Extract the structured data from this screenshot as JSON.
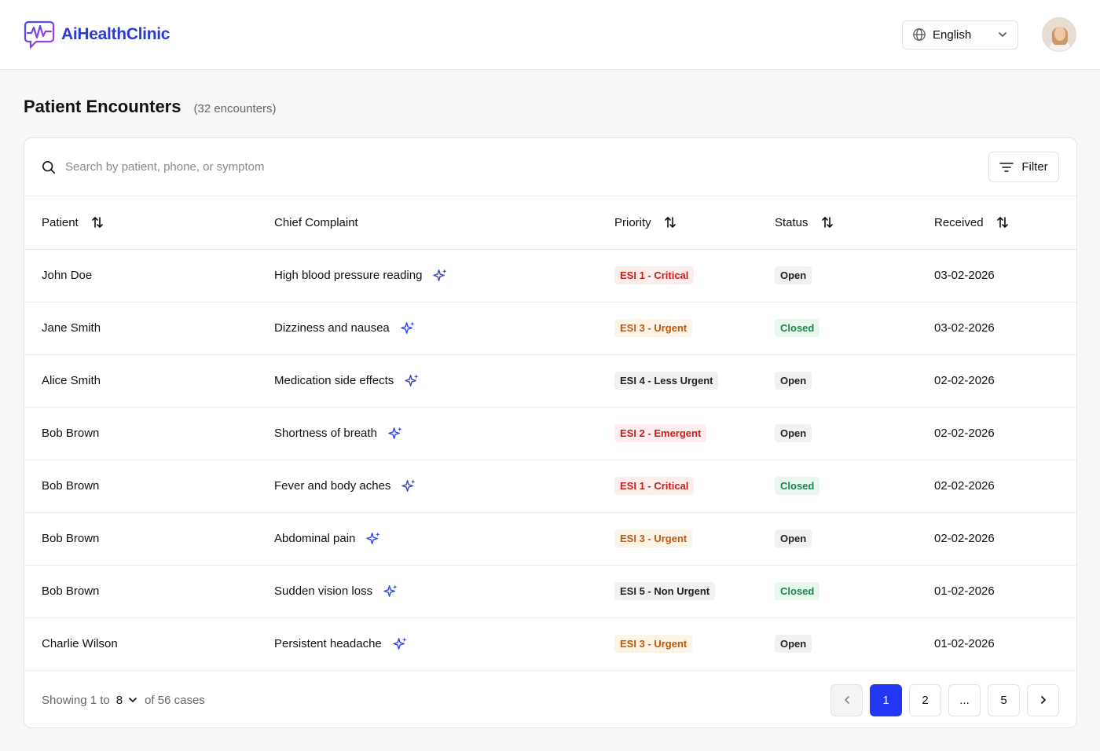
{
  "brand": {
    "name": "AiHealthClinic"
  },
  "header": {
    "language": "English"
  },
  "page": {
    "title": "Patient Encounters",
    "count": "(32 encounters)"
  },
  "search": {
    "placeholder": "Search by patient, phone, or symptom"
  },
  "filter": {
    "label": "Filter"
  },
  "columns": {
    "patient": "Patient",
    "complaint": "Chief Complaint",
    "priority": "Priority",
    "status": "Status",
    "received": "Received"
  },
  "rows": [
    {
      "patient": "John Doe",
      "complaint": "High blood pressure reading",
      "priority": "ESI 1 - Critical",
      "status": "Open",
      "received": "03-02-2026"
    },
    {
      "patient": "Jane Smith",
      "complaint": "Dizziness and nausea",
      "priority": "ESI 3 - Urgent",
      "status": "Closed",
      "received": "03-02-2026"
    },
    {
      "patient": "Alice Smith",
      "complaint": "Medication side effects",
      "priority": "ESI 4 - Less Urgent",
      "status": "Open",
      "received": "02-02-2026"
    },
    {
      "patient": "Bob Brown",
      "complaint": "Shortness of breath",
      "priority": "ESI 2 - Emergent",
      "status": "Open",
      "received": "02-02-2026"
    },
    {
      "patient": "Bob Brown",
      "complaint": "Fever and body aches",
      "priority": "ESI 1 - Critical",
      "status": "Closed",
      "received": "02-02-2026"
    },
    {
      "patient": "Bob Brown",
      "complaint": "Abdominal pain",
      "priority": "ESI 3 - Urgent",
      "status": "Open",
      "received": "02-02-2026"
    },
    {
      "patient": "Bob Brown",
      "complaint": "Sudden vision loss",
      "priority": "ESI 5 - Non Urgent",
      "status": "Closed",
      "received": "01-02-2026"
    },
    {
      "patient": "Charlie Wilson",
      "complaint": "Persistent headache",
      "priority": "ESI 3 - Urgent",
      "status": "Open",
      "received": "01-02-2026"
    }
  ],
  "footer": {
    "showing_prefix": "Showing 1 to",
    "per_page": "8",
    "showing_suffix": "of 56 cases"
  },
  "pagination": {
    "pages": [
      "1",
      "2",
      "...",
      "5"
    ],
    "active": "1"
  },
  "colors": {
    "brand": "#2a3bd6",
    "primary": "#2436f5",
    "sparkle": "#3346d9"
  }
}
